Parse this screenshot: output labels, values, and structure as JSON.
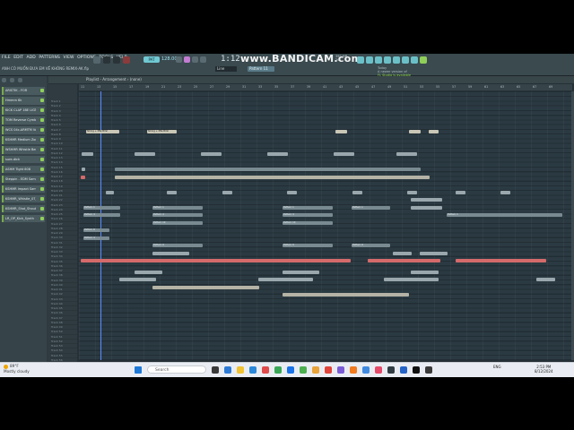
{
  "app": {
    "menu": [
      "FILE",
      "EDIT",
      "ADD",
      "PATTERNS",
      "VIEW",
      "OPTIONS",
      "TOOLS",
      "HELP"
    ],
    "song_title": "ANH CÓ MUỐN ĐƯA EM VỀ KHÔNG REMIX-AK.flp",
    "pattern_mode": "PAT",
    "tempo": "128.000",
    "clock": "1:12",
    "watermark": "www.BANDICAM.com",
    "cpu": "392 MB",
    "cpu_sub": "26",
    "line_mode": "Line",
    "pattern_select": "Pattern 11",
    "news_date": "Today",
    "news_line1": "A newer version of",
    "news_line2": "FL Studio is available"
  },
  "channels": [
    "ARISTIK - FOR",
    "Hmmm 6k",
    "KICK CLAP 1BE LIGT",
    "TOM Reverse Cymbal",
    "WCS 04c-ARMTM Va",
    "KSHMR Medium Zoom",
    "WSHMR Whistle Bee 1",
    "sure-dick",
    "ASHM Tight 808",
    "Steppin - EDM Sample",
    "KSHMR Impact Sample",
    "KSHMR_Whistle_07_1",
    "KSHMR_Shot_Shout",
    "LR_OP_Kick_Synth"
  ],
  "playlist": {
    "title": "Playlist - Arrangement › (none)",
    "ruler": [
      "11",
      "13",
      "15",
      "17",
      "19",
      "21",
      "23",
      "25",
      "27",
      "29",
      "31",
      "33",
      "35",
      "37",
      "39",
      "41",
      "43",
      "45",
      "47",
      "49",
      "51",
      "53",
      "55",
      "57",
      "59",
      "61",
      "63",
      "65",
      "67",
      "69"
    ],
    "tracks": [
      "Track 1",
      "Track 2",
      "Track 3",
      "Track 4",
      "Track 5",
      "Track 6",
      "Track 7",
      "Track 8",
      "Track 9",
      "Track 10",
      "Track 11",
      "Track 12",
      "Track 13",
      "Track 14",
      "Track 15",
      "Track 16",
      "Track 17",
      "Track 18",
      "Track 19",
      "Track 20",
      "Track 21",
      "Track 22",
      "Track 23",
      "Track 24",
      "Track 25",
      "Track 26",
      "Track 27",
      "Track 28",
      "Track 29",
      "Track 30",
      "Track 31",
      "Track 32",
      "Track 33",
      "Track 34",
      "Track 35",
      "Track 36",
      "Track 37",
      "Track 38",
      "Track 39",
      "Track 40",
      "Track 41",
      "Track 42",
      "Track 43",
      "Track 44",
      "Track 45",
      "Track 46",
      "Track 47",
      "Track 48",
      "Track 49",
      "Track 50",
      "Track 51",
      "Track 52",
      "Track 53",
      "Track 54",
      "Track 55",
      "Track 56",
      "Track 57",
      "Track 58",
      "Track 59",
      "Track 60",
      "Track 61",
      "Track 62",
      "Track 63",
      "Track 64",
      "Track 65",
      "Track 66",
      "Track 67",
      "Track 68",
      "Track 69",
      "Track 70"
    ],
    "clip_labels": {
      "string": "String + Mte Bmil",
      "pattern1": "Pattern 1",
      "pattern4": "Pattern 4",
      "pattern8": "Pattern 8",
      "pattern9": "Pattern 9",
      "pattern10": "Pattern 10",
      "pattern7": "Pattern 7",
      "pattern5": "Pattern 5"
    }
  },
  "taskbar": {
    "temp": "89°F",
    "weather": "Mostly cloudy",
    "search": "Search",
    "lang": "ENG",
    "time": "2:53 PM",
    "date": "8/12/2024"
  }
}
